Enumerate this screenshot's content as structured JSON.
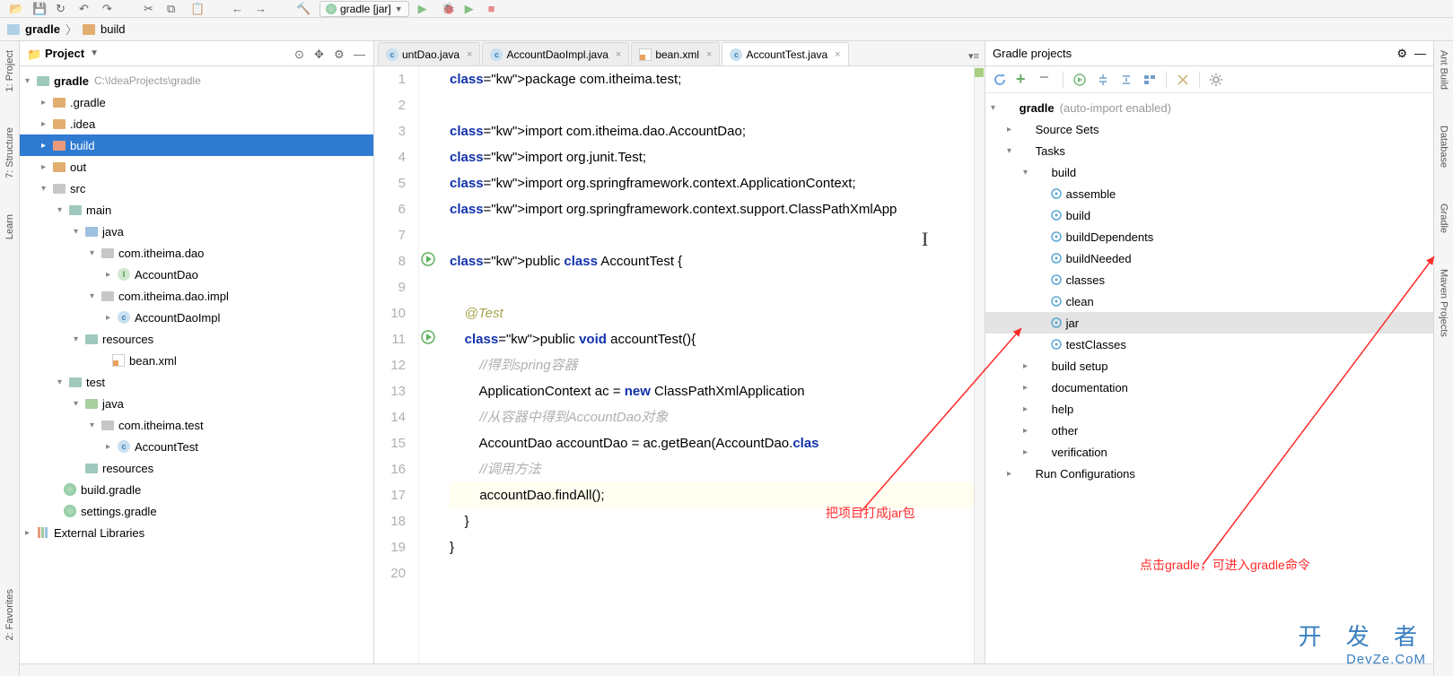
{
  "run_config": "gradle [jar]",
  "breadcrumb": {
    "root": "gradle",
    "current": "build"
  },
  "left_tabs": {
    "project": "1: Project",
    "structure": "7: Structure",
    "learn": "Learn",
    "favorites": "2: Favorites"
  },
  "right_tabs": {
    "ant": "Ant Build",
    "database": "Database",
    "gradle": "Gradle",
    "maven": "Maven Projects"
  },
  "project_panel": {
    "title": "Project",
    "root": "gradle",
    "root_path": "C:\\IdeaProjects\\gradle",
    "items": {
      "dot_gradle": ".gradle",
      "dot_idea": ".idea",
      "build": "build",
      "out": "out",
      "src": "src",
      "main": "main",
      "java": "java",
      "pkg_dao": "com.itheima.dao",
      "cls_accountdao": "AccountDao",
      "pkg_dao_impl": "com.itheima.dao.impl",
      "cls_accountdaoimpl": "AccountDaoImpl",
      "resources": "resources",
      "bean_xml": "bean.xml",
      "test": "test",
      "java_test": "java",
      "pkg_test": "com.itheima.test",
      "cls_accounttest": "AccountTest",
      "resources_test": "resources",
      "build_gradle": "build.gradle",
      "settings_gradle": "settings.gradle",
      "ext_libs": "External Libraries"
    }
  },
  "editor_tabs": [
    {
      "label": "untDao.java",
      "icon": "class"
    },
    {
      "label": "AccountDaoImpl.java",
      "icon": "class"
    },
    {
      "label": "bean.xml",
      "icon": "xml"
    },
    {
      "label": "AccountTest.java",
      "icon": "class",
      "active": true
    }
  ],
  "code": {
    "lines": [
      "package com.itheima.test;",
      "",
      "import com.itheima.dao.AccountDao;",
      "import org.junit.Test;",
      "import org.springframework.context.ApplicationContext;",
      "import org.springframework.context.support.ClassPathXmlApp",
      "",
      "public class AccountTest {",
      "",
      "    @Test",
      "    public void accountTest(){",
      "        //得到spring容器",
      "        ApplicationContext ac = new ClassPathXmlApplication",
      "        //从容器中得到AccountDao对象",
      "        AccountDao accountDao = ac.getBean(AccountDao.clas",
      "        //调用方法",
      "        accountDao.findAll();",
      "    }",
      "}",
      ""
    ],
    "line_nums": [
      "1",
      "2",
      "3",
      "4",
      "5",
      "6",
      "7",
      "8",
      "9",
      "10",
      "11",
      "12",
      "13",
      "14",
      "15",
      "16",
      "17",
      "18",
      "19",
      "20"
    ]
  },
  "gradle_panel": {
    "title": "Gradle projects",
    "root": "gradle",
    "root_hint": "(auto-import enabled)",
    "nodes": {
      "source_sets": "Source Sets",
      "tasks": "Tasks",
      "build": "build",
      "assemble": "assemble",
      "build_task": "build",
      "build_dependents": "buildDependents",
      "build_needed": "buildNeeded",
      "classes": "classes",
      "clean": "clean",
      "jar": "jar",
      "test_classes": "testClasses",
      "build_setup": "build setup",
      "documentation": "documentation",
      "help": "help",
      "other": "other",
      "verification": "verification",
      "run_configs": "Run Configurations"
    }
  },
  "annotations": {
    "jar_note": "把项目打成jar包",
    "gradle_note": "点击gradle，可进入gradle命令"
  },
  "watermark": {
    "line1": "开 发 者",
    "line2": "DevZe.CoM"
  }
}
